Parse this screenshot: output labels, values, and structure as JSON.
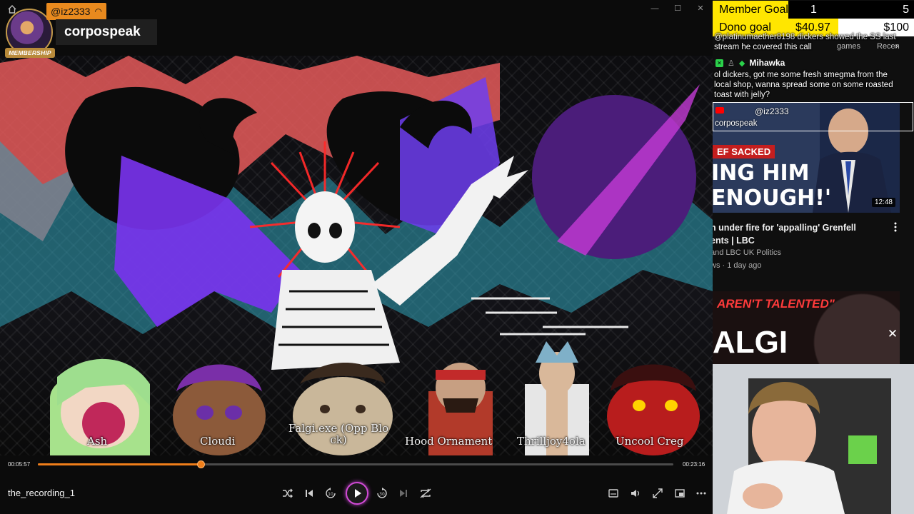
{
  "stream": {
    "handle": "@iz2333",
    "channel_name": "corpospeak",
    "membership_badge": "MEMBERSHIP"
  },
  "player": {
    "characters": [
      {
        "name": "Ash",
        "color": "#9ede8e"
      },
      {
        "name": "Cloudi",
        "color": "#8c5a3a"
      },
      {
        "name": "Falgi.exe (Opp Blo ck)",
        "color": "#c9b79a"
      },
      {
        "name": "Hood Ornament",
        "color": "#b23a2a"
      },
      {
        "name": "Thrilljoy4ola",
        "color": "#d8d8d8"
      },
      {
        "name": "Uncool Creg",
        "color": "#b81d1d"
      }
    ],
    "time_current": "00:05:57",
    "time_total": "00:23:16",
    "progress": 0.2557,
    "file_name": "the_recording_1",
    "accent": "#ef7e1a",
    "controls": [
      "shuffle-icon",
      "previous-icon",
      "rewind-10-icon",
      "play-icon",
      "forward-30-icon",
      "next-icon",
      "repeat-off-icon"
    ],
    "right_controls": [
      "subtitles-icon",
      "volume-icon",
      "fullscreen-icon",
      "popout-icon",
      "more-icon"
    ]
  },
  "goals": {
    "member": {
      "label": "Member Goal",
      "current": "1",
      "target": "5",
      "color": "#ffe600"
    },
    "dono": {
      "label": "Dono goal",
      "current": "$40.97",
      "target": "$100",
      "color": "#ffe600"
    }
  },
  "chat": {
    "line1a": "@platinumaether8198 dickers showed the SS last",
    "line1b": "stream he covered this call",
    "tab_games": "games",
    "tab_recent": "Recen",
    "author": "Mihawka",
    "msg2a": "ol dickers, got me some fresh smegma from the",
    "msg2b": "local shop, wanna spread some on some roasted",
    "msg2c": "toast with jelly?",
    "popup_handle": "@iz2333",
    "popup_channel": "corpospeak"
  },
  "recommended": {
    "thumb_banner": "EF SACKED",
    "thumb_headline_1": "ING HIM",
    "thumb_headline_2": "ENOUGH!'",
    "duration": "12:48",
    "title_1": "n under fire for 'appalling' Grenfell",
    "title_2": "ents | LBC",
    "channel": "and LBC UK Politics",
    "meta": "ws · 1 day ago",
    "thumb2_text": "AREN'T TALENTED\"",
    "thumb2_big": "ALGI"
  }
}
